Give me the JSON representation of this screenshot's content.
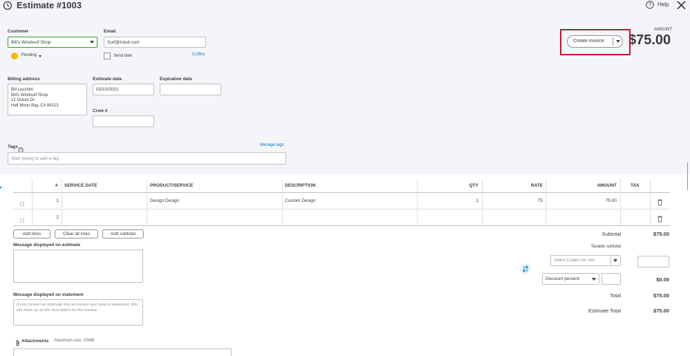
{
  "header": {
    "title": "Estimate #1003",
    "help_label": "Help",
    "amount_label": "AMOUNT",
    "amount_value": "$75.00"
  },
  "customer": {
    "label": "Customer",
    "value": "Bill's Windsurf Shop",
    "status": "Pending"
  },
  "email": {
    "label": "Email",
    "value": "Surf@Intuit.com",
    "send_later_label": "Send later",
    "ccbcc_label": "Cc/Bcc"
  },
  "create_invoice": {
    "label": "Create invoice"
  },
  "billing": {
    "label": "Billing address",
    "lines": [
      "Bill Lucchini",
      "Bill's Windsurf Shop",
      "12 Ocean Dr.",
      "Half Moon Bay, CA  94213"
    ]
  },
  "estimate_date": {
    "label": "Estimate date",
    "value": "02/10/2021"
  },
  "expiration_date": {
    "label": "Expiration date",
    "value": ""
  },
  "crew": {
    "label": "Crew #",
    "value": ""
  },
  "tags": {
    "label": "Tags",
    "placeholder": "Start typing to add a tag",
    "manage_label": "Manage tags"
  },
  "table": {
    "headers": {
      "num": "#",
      "service_date": "SERVICE DATE",
      "product": "PRODUCT/SERVICE",
      "description": "DESCRIPTION",
      "qty": "QTY",
      "rate": "RATE",
      "amount": "AMOUNT",
      "tax": "TAX"
    },
    "rows": [
      {
        "num": "1",
        "service_date": "",
        "product": "Design:Design",
        "description": "Custom Design",
        "qty": "1",
        "rate": "75",
        "amount": "75.00"
      },
      {
        "num": "2",
        "service_date": "",
        "product": "",
        "description": "",
        "qty": "",
        "rate": "",
        "amount": ""
      }
    ]
  },
  "actions": {
    "add_lines": "Add lines",
    "clear_lines": "Clear all lines",
    "add_subtotal": "Add subtotal"
  },
  "messages": {
    "estimate_label": "Message displayed on estimate",
    "statement_label": "Message displayed on statement",
    "statement_placeholder": "If you convert an estimate into an invoice and send a statement, this will show up as the description for the invoice."
  },
  "attachments": {
    "label": "Attachments",
    "max_size": "Maximum size: 20MB"
  },
  "totals": {
    "subtotal_label": "Subtotal",
    "subtotal_value": "$75.00",
    "taxable_subtotal_label": "Taxable subtotal",
    "tax_rate_placeholder": "Select a sales tax rate",
    "discount_label": "Discount percent",
    "discount_value": "$0.00",
    "total_label": "Total",
    "total_value": "$75.00",
    "estimate_total_label": "Estimate Total",
    "estimate_total_value": "$75.00"
  },
  "colors": {
    "accent_link": "#0077c5",
    "highlight_box": "#c8102e",
    "customer_border": "#2ca01c",
    "pending": "#f2b705"
  }
}
